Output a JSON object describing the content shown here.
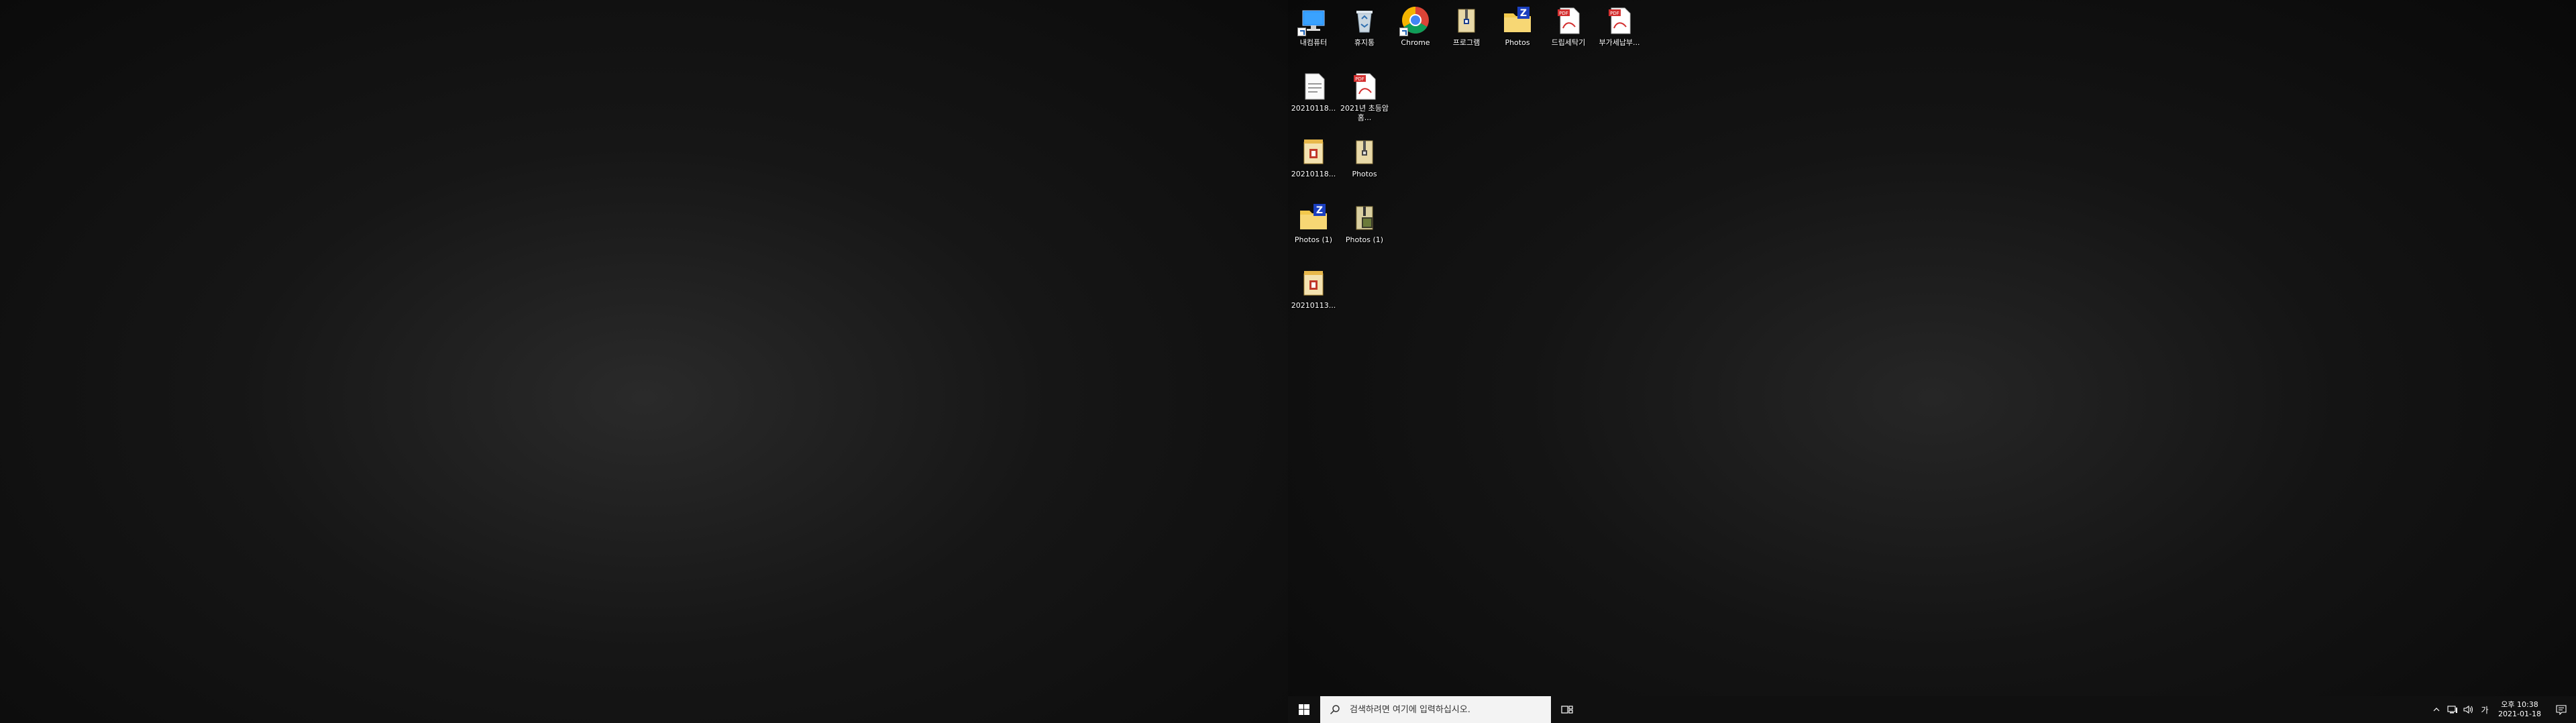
{
  "desktop": {
    "icons": [
      {
        "label": "내컴퓨터",
        "icon": "computer-icon"
      },
      {
        "label": "휴지통",
        "icon": "recycle-bin-icon"
      },
      {
        "label": "Chrome",
        "icon": "chrome-icon"
      },
      {
        "label": "프로그램",
        "icon": "zip-folder-icon"
      },
      {
        "label": "Photos",
        "icon": "folder-zip-icon"
      },
      {
        "label": "드립세탁기",
        "icon": "pdf-icon"
      },
      {
        "label": "부가세납부...",
        "icon": "pdf-icon"
      },
      {
        "label": "20210118...",
        "icon": "document-icon"
      },
      {
        "label": "2021년 초등암 홈...",
        "icon": "pdf-icon"
      },
      {
        "label": "20210118...",
        "icon": "archive-icon"
      },
      {
        "label": "Photos",
        "icon": "zip-folder-icon"
      },
      {
        "label": "Photos (1)",
        "icon": "folder-zip-icon"
      },
      {
        "label": "Photos (1)",
        "icon": "zip-folder-icon"
      },
      {
        "label": "20210113...",
        "icon": "archive-icon"
      }
    ]
  },
  "taskbar": {
    "search_placeholder": "검색하려면 여기에 입력하십시오.",
    "tray": {
      "ime_label": "가",
      "time": "오후 10:38",
      "date": "2021-01-18"
    }
  }
}
